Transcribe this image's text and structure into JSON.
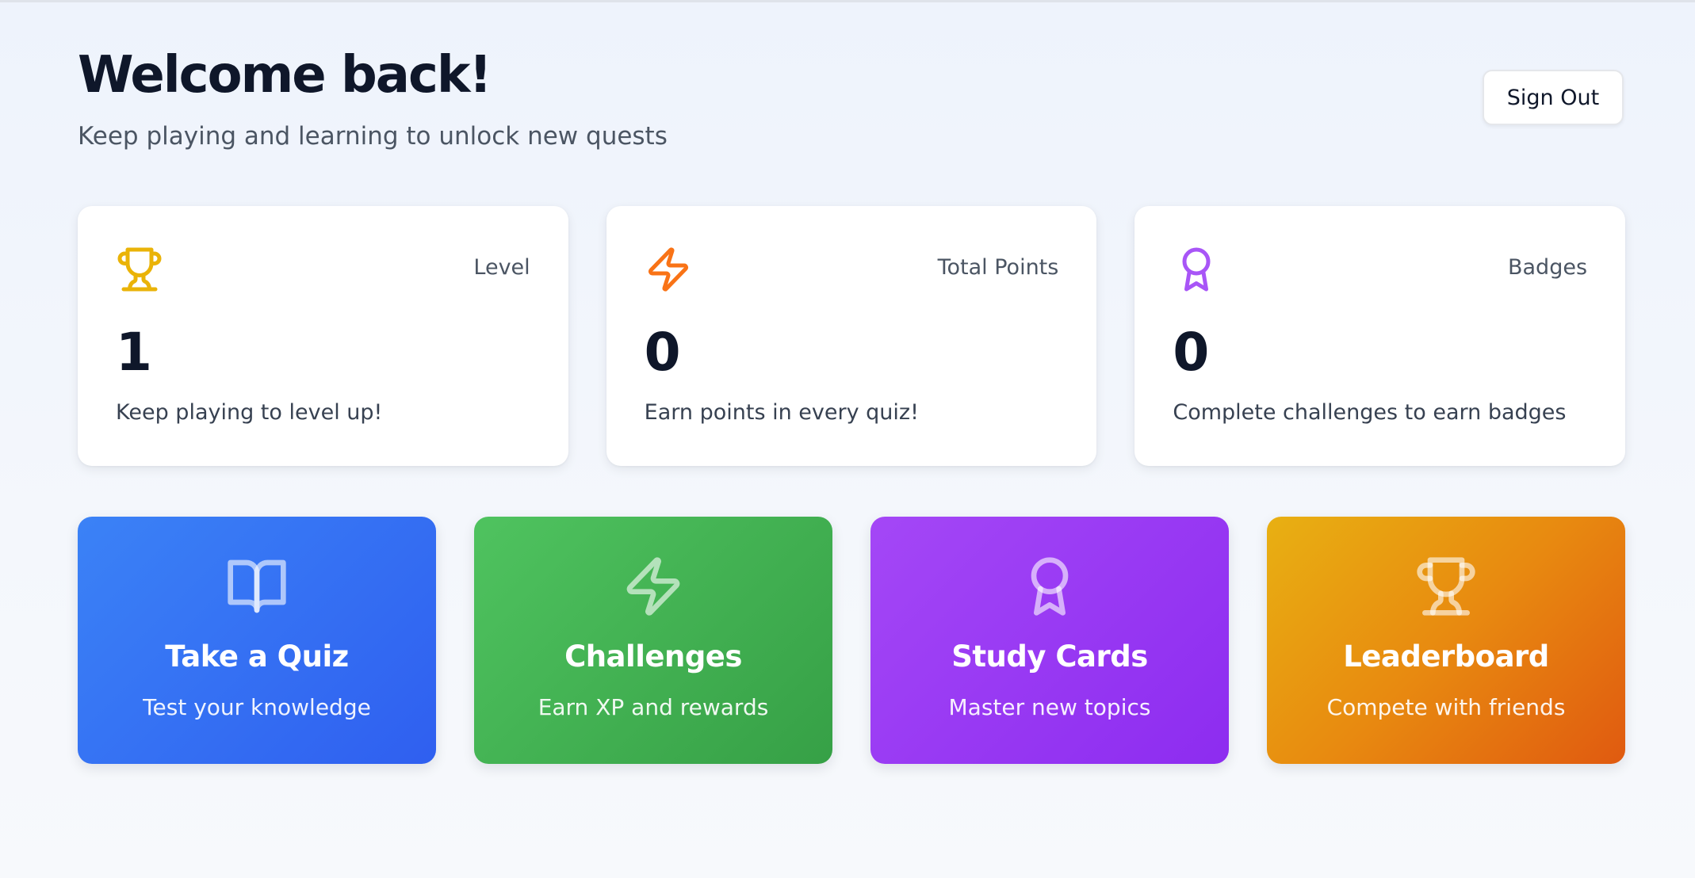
{
  "header": {
    "title": "Welcome back!",
    "subtitle": "Keep playing and learning to unlock new quests",
    "sign_out_label": "Sign Out"
  },
  "stats": [
    {
      "icon": "trophy-icon",
      "label": "Level",
      "value": "1",
      "description": "Keep playing to level up!",
      "color": "#eab308"
    },
    {
      "icon": "lightning-icon",
      "label": "Total Points",
      "value": "0",
      "description": "Earn points in every quiz!",
      "color": "#f97316"
    },
    {
      "icon": "award-icon",
      "label": "Badges",
      "value": "0",
      "description": "Complete challenges to earn badges",
      "color": "#a855f7"
    }
  ],
  "actions": [
    {
      "icon": "book-icon",
      "title": "Take a Quiz",
      "subtitle": "Test your knowledge",
      "color": "#3b82f6"
    },
    {
      "icon": "lightning-icon",
      "title": "Challenges",
      "subtitle": "Earn XP and rewards",
      "color": "#22c55e"
    },
    {
      "icon": "award-icon",
      "title": "Study Cards",
      "subtitle": "Master new topics",
      "color": "#a855f7"
    },
    {
      "icon": "trophy-icon",
      "title": "Leaderboard",
      "subtitle": "Compete with friends",
      "color": "#f59e0b"
    }
  ]
}
